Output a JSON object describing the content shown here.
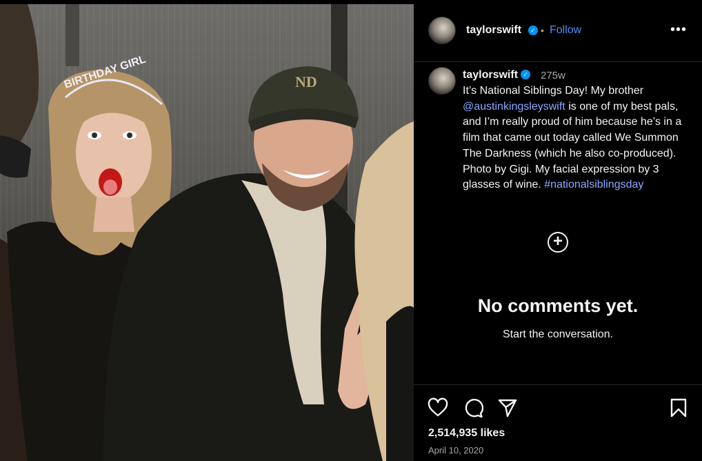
{
  "header": {
    "username": "taylorswift",
    "separator": "•",
    "follow_label": "Follow",
    "verified_icon": "verified-badge-icon",
    "more_icon": "more-options-icon"
  },
  "caption": {
    "username": "taylorswift",
    "time_ago": "275w",
    "text_before_mention": "It’s National Siblings Day! My brother ",
    "mention": "@austinkingsleyswift",
    "text_after_mention": " is one of my best pals, and I’m really proud of him because he’s in a film that came out today called We Summon The Darkness (which he also co-produced). Photo by Gigi. My facial expression by 3 glasses of wine. ",
    "hashtag": "#nationalsiblingsday"
  },
  "comments": {
    "add_icon": "add-circle-icon",
    "empty_title": "No comments yet.",
    "empty_subtitle": "Start the conversation."
  },
  "actions": {
    "icons": [
      "heart-icon",
      "comment-icon",
      "share-icon",
      "bookmark-icon"
    ],
    "likes": "2,514,935 likes",
    "date": "April 10, 2020"
  },
  "photo": {
    "headband_text": "BIRTHDAY GIRL",
    "cap_logo": "ND"
  },
  "colors": {
    "background": "#000000",
    "link": "#8ea8ff",
    "follow": "#4f8ff7",
    "verified": "#0095f6",
    "muted": "#a8a8a8"
  }
}
